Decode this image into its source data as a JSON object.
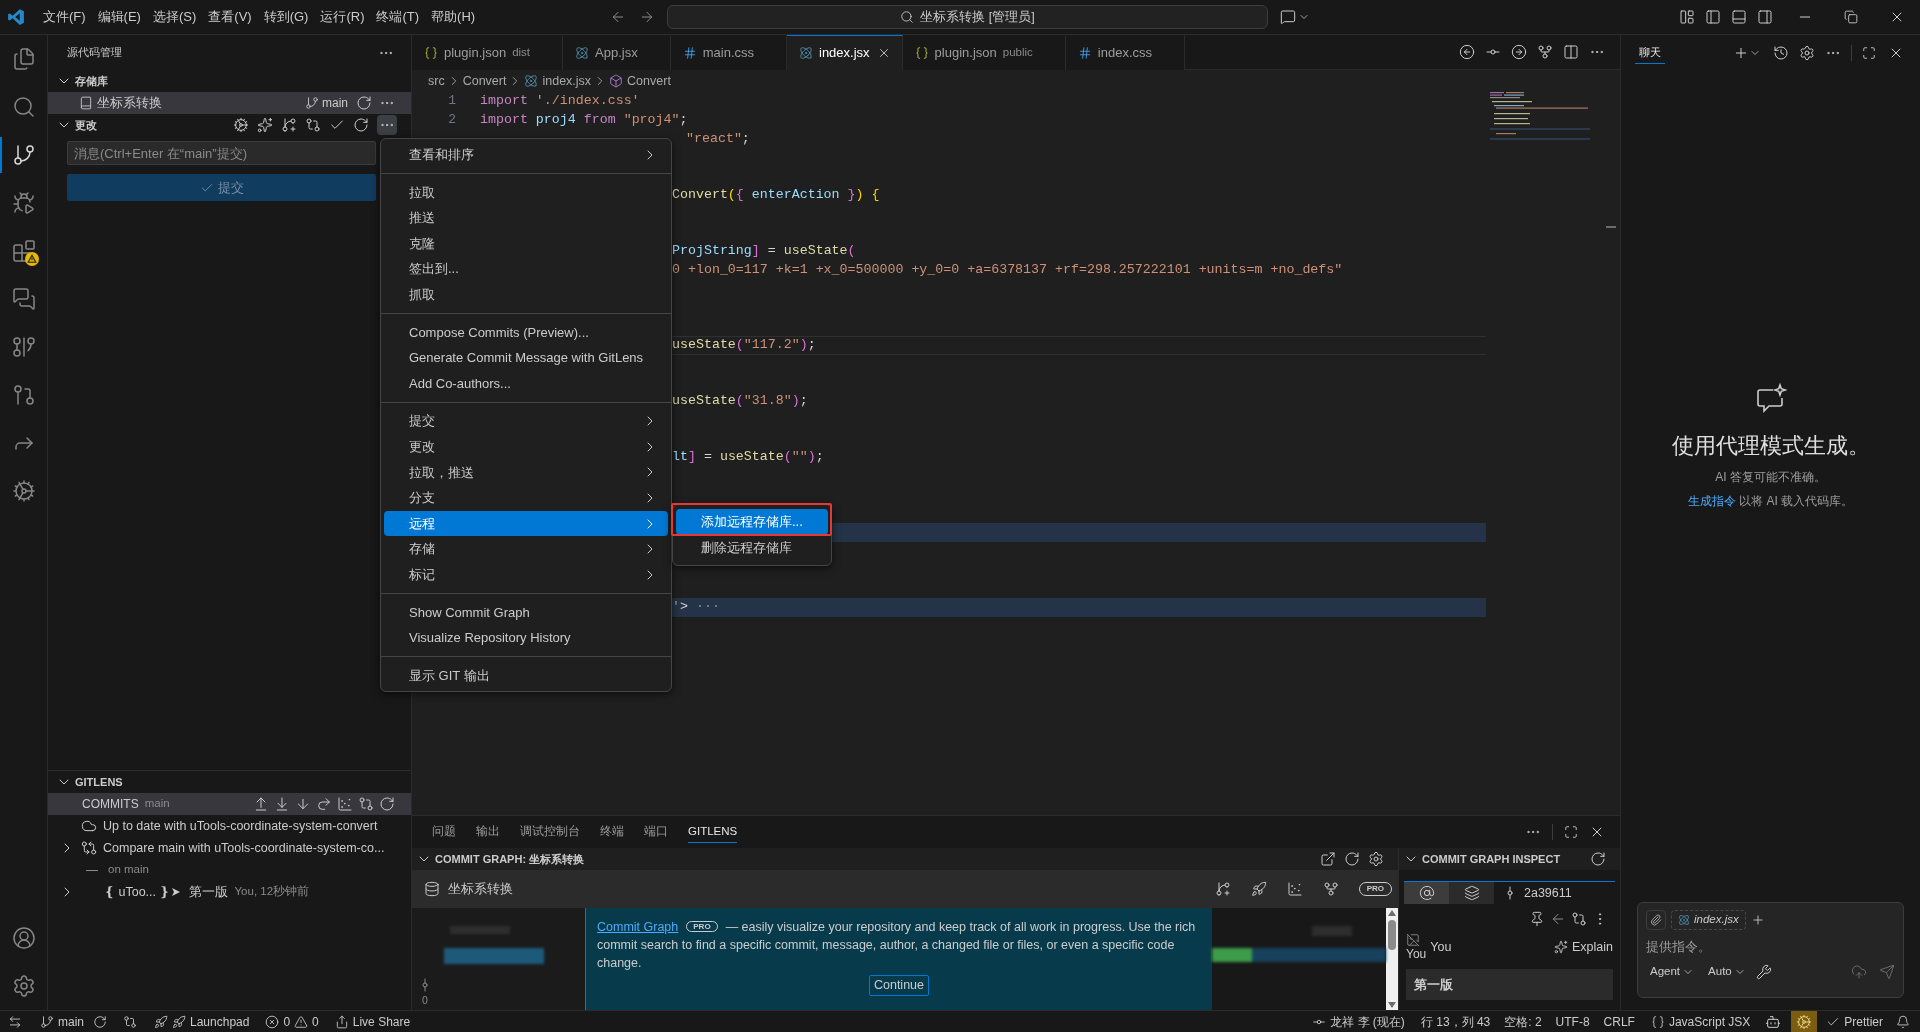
{
  "title_bar": {
    "menus": [
      "文件(F)",
      "编辑(E)",
      "选择(S)",
      "查看(V)",
      "转到(G)",
      "运行(R)",
      "终端(T)",
      "帮助(H)"
    ],
    "search": "坐标系转换 [管理员]"
  },
  "activity_bar": {
    "items": [
      {
        "selected": false,
        "warning": false
      },
      {
        "selected": false,
        "warning": false
      },
      {
        "selected": true,
        "warning": false
      },
      {
        "selected": false,
        "warning": false
      },
      {
        "selected": false,
        "warning": true
      },
      {
        "selected": false,
        "warning": false
      },
      {
        "selected": false,
        "warning": false
      },
      {
        "selected": false,
        "warning": false
      },
      {
        "selected": false,
        "warning": false
      },
      {
        "selected": false,
        "warning": false
      }
    ]
  },
  "sidebar": {
    "title": "源代码管理",
    "repositories": {
      "title": "存储库",
      "expanded": true,
      "items": [
        {
          "name": "坐标系转换",
          "branch": "main",
          "selected": true
        }
      ]
    },
    "changes": {
      "title": "更改",
      "expanded": true,
      "more_open": true,
      "message": {
        "placeholder": "消息(Ctrl+Enter 在“main”提交)"
      },
      "commit_button": {
        "label": "提交",
        "disabled": true
      }
    },
    "gitlens": {
      "title": "GITLENS",
      "expanded": true,
      "commits": {
        "label": "COMMITS",
        "branch": "main",
        "selected": true,
        "children": [
          {
            "kind": "status",
            "text": "Up to date with uTools-coordinate-system-convert"
          },
          {
            "kind": "compare",
            "text": "Compare main with uTools-coordinate-system-co...",
            "expanded": false
          },
          {
            "kind": "branch_line",
            "text": "on main"
          },
          {
            "kind": "commit",
            "ref": "❴ uToo... ❵",
            "message": "第一版",
            "meta": "You, 12秒钟前",
            "expanded": false
          }
        ]
      }
    }
  },
  "editor": {
    "tabs": [
      {
        "name": "plugin.json",
        "detail": "dist",
        "kind": "json",
        "selected": false
      },
      {
        "name": "App.jsx",
        "kind": "react",
        "selected": false
      },
      {
        "name": "main.css",
        "kind": "css",
        "selected": false
      },
      {
        "name": "index.jsx",
        "kind": "react",
        "selected": true
      },
      {
        "name": "plugin.json",
        "detail": "public",
        "kind": "json",
        "selected": false
      },
      {
        "name": "index.css",
        "kind": "css",
        "selected": false
      }
    ],
    "breadcrumb": [
      {
        "kind": "folder",
        "text": "src"
      },
      {
        "kind": "folder",
        "text": "Convert"
      },
      {
        "kind": "react",
        "text": "index.jsx"
      },
      {
        "kind": "component",
        "text": "Convert"
      }
    ],
    "lines": [
      {
        "number": "1",
        "tokens": [
          {
            "kind": "keyword",
            "text": "import "
          },
          {
            "kind": "string",
            "text": "'./index.css'"
          }
        ]
      },
      {
        "number": "2",
        "tokens": [
          {
            "kind": "keyword",
            "text": "import "
          },
          {
            "kind": "variable",
            "text": "proj4 "
          },
          {
            "kind": "keyword",
            "text": "from "
          },
          {
            "kind": "string",
            "text": "\"proj4\""
          },
          {
            "kind": "plain",
            "text": ";"
          }
        ]
      }
    ],
    "fragments": [
      {
        "tokens": [
          {
            "kind": "string",
            "text": "\"react\""
          },
          {
            "kind": "plain",
            "text": ";"
          }
        ],
        "current": false,
        "highlighted": false
      },
      {
        "tokens": [
          {
            "kind": "function",
            "text": "Convert"
          },
          {
            "kind": "bracket1",
            "text": "("
          },
          {
            "kind": "bracket2",
            "text": "{"
          },
          {
            "kind": "variable",
            "text": " enterAction "
          },
          {
            "kind": "bracket2",
            "text": "}"
          },
          {
            "kind": "bracket1",
            "text": ") {"
          }
        ],
        "current": false,
        "highlighted": false
      },
      {
        "tokens": [
          {
            "kind": "variable",
            "text": "ProjString"
          },
          {
            "kind": "bracket2",
            "text": "]"
          },
          {
            "kind": "plain",
            "text": " = "
          },
          {
            "kind": "function",
            "text": "useState"
          },
          {
            "kind": "bracket2",
            "text": "("
          }
        ],
        "current": false,
        "highlighted": false
      },
      {
        "tokens": [
          {
            "kind": "string",
            "text": "0 +lon_0=117 +k=1 +x_0=500000 +y_0=0 +a=6378137 +rf=298.257222101 +units=m +no_defs\""
          }
        ],
        "current": false,
        "highlighted": false
      },
      {
        "tokens": [
          {
            "kind": "function",
            "text": "useState"
          },
          {
            "kind": "bracket2",
            "text": "("
          },
          {
            "kind": "string",
            "text": "\"117.2\""
          },
          {
            "kind": "bracket2",
            "text": ")"
          },
          {
            "kind": "plain",
            "text": ";"
          }
        ],
        "current": true,
        "highlighted": false
      },
      {
        "tokens": [
          {
            "kind": "function",
            "text": "useState"
          },
          {
            "kind": "bracket2",
            "text": "("
          },
          {
            "kind": "string",
            "text": "\"31.8\""
          },
          {
            "kind": "bracket2",
            "text": ")"
          },
          {
            "kind": "plain",
            "text": ";"
          }
        ],
        "current": false,
        "highlighted": false
      },
      {
        "tokens": [
          {
            "kind": "variable",
            "text": "lt"
          },
          {
            "kind": "bracket2",
            "text": "]"
          },
          {
            "kind": "plain",
            "text": " = "
          },
          {
            "kind": "function",
            "text": "useState"
          },
          {
            "kind": "bracket2",
            "text": "("
          },
          {
            "kind": "string",
            "text": "\"\""
          },
          {
            "kind": "bracket2",
            "text": ")"
          },
          {
            "kind": "plain",
            "text": ";"
          }
        ],
        "current": false,
        "highlighted": false
      },
      {
        "current": false,
        "highlighted": true
      },
      {
        "tokens": [
          {
            "kind": "string",
            "text": "'"
          },
          {
            "kind": "plain",
            "text": "> "
          },
          {
            "kind": "fold",
            "text": "···"
          }
        ],
        "current": false,
        "highlighted": true
      }
    ]
  },
  "context_menu": {
    "groups": [
      {
        "items": [
          {
            "label": "查看和排序",
            "submenu": true,
            "selected": false
          }
        ]
      },
      {
        "items": [
          {
            "label": "拉取",
            "submenu": false,
            "selected": false
          },
          {
            "label": "推送",
            "submenu": false,
            "selected": false
          },
          {
            "label": "克隆",
            "submenu": false,
            "selected": false
          },
          {
            "label": "签出到...",
            "submenu": false,
            "selected": false
          },
          {
            "label": "抓取",
            "submenu": false,
            "selected": false
          }
        ]
      },
      {
        "items": [
          {
            "label": "Compose Commits (Preview)...",
            "submenu": false,
            "selected": false
          },
          {
            "label": "Generate Commit Message with GitLens",
            "submenu": false,
            "selected": false
          },
          {
            "label": "Add Co-authors...",
            "submenu": false,
            "selected": false
          }
        ]
      },
      {
        "items": [
          {
            "label": "提交",
            "submenu": true,
            "selected": false
          },
          {
            "label": "更改",
            "submenu": true,
            "selected": false
          },
          {
            "label": "拉取，推送",
            "submenu": true,
            "selected": false
          },
          {
            "label": "分支",
            "submenu": true,
            "selected": false
          },
          {
            "label": "远程",
            "submenu": true,
            "selected": true
          },
          {
            "label": "存储",
            "submenu": true,
            "selected": false
          },
          {
            "label": "标记",
            "submenu": true,
            "selected": false
          }
        ]
      },
      {
        "items": [
          {
            "label": "Show Commit Graph",
            "submenu": false,
            "selected": false
          },
          {
            "label": "Visualize Repository History",
            "submenu": false,
            "selected": false
          }
        ]
      },
      {
        "items": [
          {
            "label": "显示 GIT 输出",
            "submenu": false,
            "selected": false
          }
        ]
      }
    ]
  },
  "submenu": {
    "items": [
      {
        "label": "添加远程存储库...",
        "selected": true
      },
      {
        "label": "删除远程存储库",
        "selected": false
      }
    ]
  },
  "panel": {
    "tabs": [
      {
        "label": "问题",
        "selected": false
      },
      {
        "label": "输出",
        "selected": false
      },
      {
        "label": "调试控制台",
        "selected": false
      },
      {
        "label": "终端",
        "selected": false
      },
      {
        "label": "端口",
        "selected": false
      },
      {
        "label": "GITLENS",
        "selected": true
      }
    ],
    "commit_graph": {
      "title": "COMMIT GRAPH: 坐标系转换",
      "expanded": true,
      "repo": "坐标系转换",
      "badge": "PRO",
      "gutter_count": "0",
      "promo": {
        "link": "Commit Graph",
        "badge": "PRO",
        "text": "— easily visualize your repository and keep track of all work in progress. Use the rich commit search to find a specific commit, message, author, a changed file or files, or even a specific code change.",
        "button": "Continue"
      }
    },
    "inspect": {
      "title": "COMMIT GRAPH INSPECT",
      "expanded": true,
      "tabs": [
        {
          "selected": true
        },
        {
          "selected": false
        }
      ],
      "sha": "2a39611",
      "avatar_alt": "You",
      "author": "You",
      "explain": "Explain",
      "message": "第一版"
    }
  },
  "chat": {
    "tabs": [
      {
        "label": "聊天",
        "selected": true
      }
    ],
    "heading": "使用代理模式生成。",
    "disclaimer": "AI 答复可能不准确。",
    "hint": {
      "link": "生成指令",
      "text": "以将 AI 载入代码库。"
    },
    "input": {
      "context_file": "index.jsx",
      "placeholder": "提供指令。",
      "mode": "Agent",
      "model": "Auto"
    }
  },
  "status_bar": {
    "branch": "main",
    "launchpad": "Launchpad",
    "errors": "0",
    "warnings": "0",
    "live_share": "Live Share",
    "author": "龙祥 李 (现在)",
    "position": "行 13，列 43",
    "indent": "空格: 2",
    "encoding": "UTF-8",
    "eol": "CRLF",
    "language": "JavaScript JSX",
    "formatter": "Prettier"
  }
}
